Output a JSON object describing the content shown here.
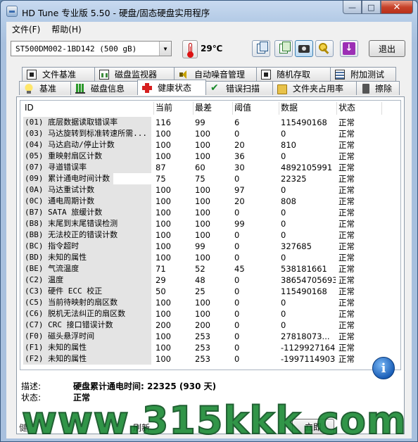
{
  "window": {
    "title": "HD Tune 专业版 5.50 - 硬盘/固态硬盘实用程序",
    "min_glyph": "—",
    "max_glyph": "□",
    "close_glyph": "✕"
  },
  "menu": [
    "文件(F)",
    "帮助(H)"
  ],
  "toolbar": {
    "drive": "ST500DM002-1BD142 (500 gB)",
    "temperature": "29℃",
    "exit_label": "退出"
  },
  "tabs_row1": [
    "文件基准",
    "磁盘监视器",
    "自动噪音管理",
    "随机存取",
    "附加测试"
  ],
  "tabs_row2": [
    "基准",
    "磁盘信息",
    "健康状态",
    "错误扫描",
    "文件夹占用率",
    "擦除"
  ],
  "selected_tab": "健康状态",
  "table": {
    "headers": [
      "ID",
      "当前",
      "最差",
      "阈值",
      "数据",
      "状态"
    ],
    "rows": [
      {
        "id": "(01) 底层数据读取错误率",
        "cur": "116",
        "worst": "99",
        "thr": "6",
        "data": "115490168",
        "status": "正常"
      },
      {
        "id": "(03) 马达旋转到标准转速所需...",
        "cur": "100",
        "worst": "100",
        "thr": "0",
        "data": "0",
        "status": "正常"
      },
      {
        "id": "(04) 马达启动/停止计数",
        "cur": "100",
        "worst": "100",
        "thr": "20",
        "data": "810",
        "status": "正常"
      },
      {
        "id": "(05) 重映射扇区计数",
        "cur": "100",
        "worst": "100",
        "thr": "36",
        "data": "0",
        "status": "正常"
      },
      {
        "id": "(07) 寻道错误率",
        "cur": "87",
        "worst": "60",
        "thr": "30",
        "data": "4892105991",
        "status": "正常"
      },
      {
        "id": "(09) 累计通电时间计数",
        "cur": "75",
        "worst": "75",
        "thr": "0",
        "data": "22325",
        "status": "正常"
      },
      {
        "id": "(0A) 马达重试计数",
        "cur": "100",
        "worst": "100",
        "thr": "97",
        "data": "0",
        "status": "正常"
      },
      {
        "id": "(0C) 通电周期计数",
        "cur": "100",
        "worst": "100",
        "thr": "20",
        "data": "808",
        "status": "正常"
      },
      {
        "id": "(B7) SATA 旅缓计数",
        "cur": "100",
        "worst": "100",
        "thr": "0",
        "data": "0",
        "status": "正常"
      },
      {
        "id": "(B8) 末尾到末尾错误检测",
        "cur": "100",
        "worst": "100",
        "thr": "99",
        "data": "0",
        "status": "正常"
      },
      {
        "id": "(BB) 无法校正的错误计数",
        "cur": "100",
        "worst": "100",
        "thr": "0",
        "data": "0",
        "status": "正常"
      },
      {
        "id": "(BC) 指令超时",
        "cur": "100",
        "worst": "99",
        "thr": "0",
        "data": "327685",
        "status": "正常"
      },
      {
        "id": "(BD) 未知的属性",
        "cur": "100",
        "worst": "100",
        "thr": "0",
        "data": "0",
        "status": "正常"
      },
      {
        "id": "(BE) 气流温度",
        "cur": "71",
        "worst": "52",
        "thr": "45",
        "data": "538181661",
        "status": "正常"
      },
      {
        "id": "(C2) 温度",
        "cur": "29",
        "worst": "48",
        "thr": "0",
        "data": "38654705693",
        "status": "正常"
      },
      {
        "id": "(C3) 硬件 ECC 校正",
        "cur": "50",
        "worst": "25",
        "thr": "0",
        "data": "115490168",
        "status": "正常"
      },
      {
        "id": "(C5) 当前待映射的扇区数",
        "cur": "100",
        "worst": "100",
        "thr": "0",
        "data": "0",
        "status": "正常"
      },
      {
        "id": "(C6) 脱机无法纠正的扇区数",
        "cur": "100",
        "worst": "100",
        "thr": "0",
        "data": "0",
        "status": "正常"
      },
      {
        "id": "(C7) CRC 接口错误计数",
        "cur": "200",
        "worst": "200",
        "thr": "0",
        "data": "0",
        "status": "正常"
      },
      {
        "id": "(F0) 磁头悬浮时间",
        "cur": "100",
        "worst": "253",
        "thr": "0",
        "data": "27818073...",
        "status": "正常"
      },
      {
        "id": "(F1) 未知的属性",
        "cur": "100",
        "worst": "253",
        "thr": "0",
        "data": "-1129927164",
        "status": "正常"
      },
      {
        "id": "(F2) 未知的属性",
        "cur": "100",
        "worst": "253",
        "thr": "0",
        "data": "-1997114903",
        "status": "正常"
      }
    ]
  },
  "description": {
    "label": "描述:",
    "value": "硬盘累计通电时间: 22325 (930 天)",
    "status_label": "状态:",
    "status_value": "正常"
  },
  "bottom": {
    "left_fragment": "健",
    "mid_fragment": "刷新",
    "button_fragment": "立即"
  },
  "watermark": "www.315kkk.com"
}
